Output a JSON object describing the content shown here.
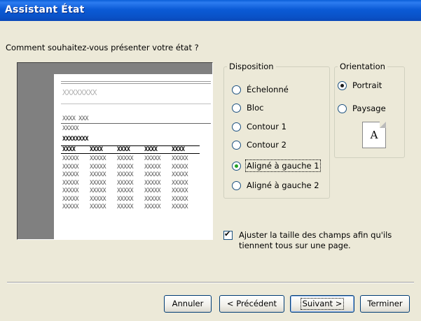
{
  "window": {
    "title": "Assistant État"
  },
  "prompt": "Comment souhaitez-vous présenter votre état ?",
  "preview": {
    "heading": "XXXXXXXX",
    "line1": "XXXX XXX",
    "line2": "XXXXX",
    "line3": "XXXXXXXX",
    "columns": [
      "XXXX",
      "XXXX",
      "XXXX",
      "XXXX",
      "XXXX"
    ],
    "row_cell": "XXXXX"
  },
  "disposition": {
    "legend": "Disposition",
    "options": [
      {
        "label": "Échelonné",
        "selected": false
      },
      {
        "label": "Bloc",
        "selected": false
      },
      {
        "label": "Contour 1",
        "selected": false
      },
      {
        "label": "Contour 2",
        "selected": false
      },
      {
        "label": "Aligné à gauche 1",
        "selected": true
      },
      {
        "label": "Aligné à gauche 2",
        "selected": false
      }
    ]
  },
  "orientation": {
    "legend": "Orientation",
    "options": [
      {
        "label": "Portrait",
        "selected": true
      },
      {
        "label": "Paysage",
        "selected": false
      }
    ],
    "page_icon_letter": "A"
  },
  "fit_checkbox": {
    "checked": true,
    "line1": "Ajuster la taille des champs afin qu'ils",
    "line2": "tiennent tous sur une page."
  },
  "buttons": {
    "cancel": "Annuler",
    "previous": "< Précédent",
    "next": "Suivant >",
    "finish": "Terminer"
  }
}
